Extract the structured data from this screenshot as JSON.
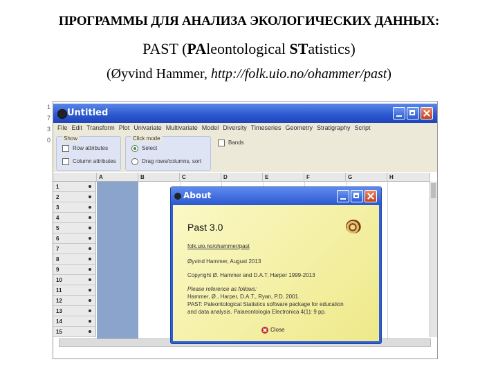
{
  "slide": {
    "title": "ПРОГРАММЫ ДЛЯ АНАЛИЗА ЭКОЛОГИЧЕСКИХ ДАННЫХ:",
    "subtitle": {
      "name": "PAST",
      "paren_open": " (",
      "pa": "PA",
      "leontological": "leontological ",
      "st": "ST",
      "atistics": "atistics)"
    },
    "credit": {
      "author": "(Øyvind Hammer, ",
      "url": "http://folk.uio.no/ohammer/past",
      "close": ")"
    }
  },
  "side_fragments": [
    "1",
    "7",
    "3",
    "0"
  ],
  "window": {
    "title": "Untitled",
    "menu": [
      "File",
      "Edit",
      "Transform",
      "Plot",
      "Univariate",
      "Multivariate",
      "Model",
      "Diversity",
      "Timeseries",
      "Geometry",
      "Stratigraphy",
      "Script"
    ],
    "toolbar": {
      "show_label": "Show",
      "row_attributes": "Row attributes",
      "column_attributes": "Column attributes",
      "click_mode_label": "Click mode",
      "select": "Select",
      "drag": "Drag rows/columns, sort",
      "bands": "Bands"
    },
    "grid": {
      "columns": [
        "A",
        "B",
        "C",
        "D",
        "E",
        "F",
        "G",
        "H"
      ],
      "rows": [
        "1",
        "2",
        "3",
        "4",
        "5",
        "6",
        "7",
        "8",
        "9",
        "10",
        "11",
        "12",
        "13",
        "14",
        "15"
      ]
    }
  },
  "about": {
    "title": "About",
    "name": "Past  3.0",
    "link": "folk.uio.no/ohammer/past",
    "author_line": "Øyvind Hammer, August 2013",
    "copyright": "Copyright  Ø. Hammer  and  D.A.T. Harper  1999-2013",
    "reference_heading": "Please reference as follows:",
    "ref1": "Hammer, Ø., Harper, D.A.T., Ryan, P.D. 2001.",
    "ref2": "PAST: Paleontological Statistics software package for education",
    "ref3": "and data analysis. Palaeontologia Electronica 4(1): 9 pp.",
    "close": "Close"
  }
}
